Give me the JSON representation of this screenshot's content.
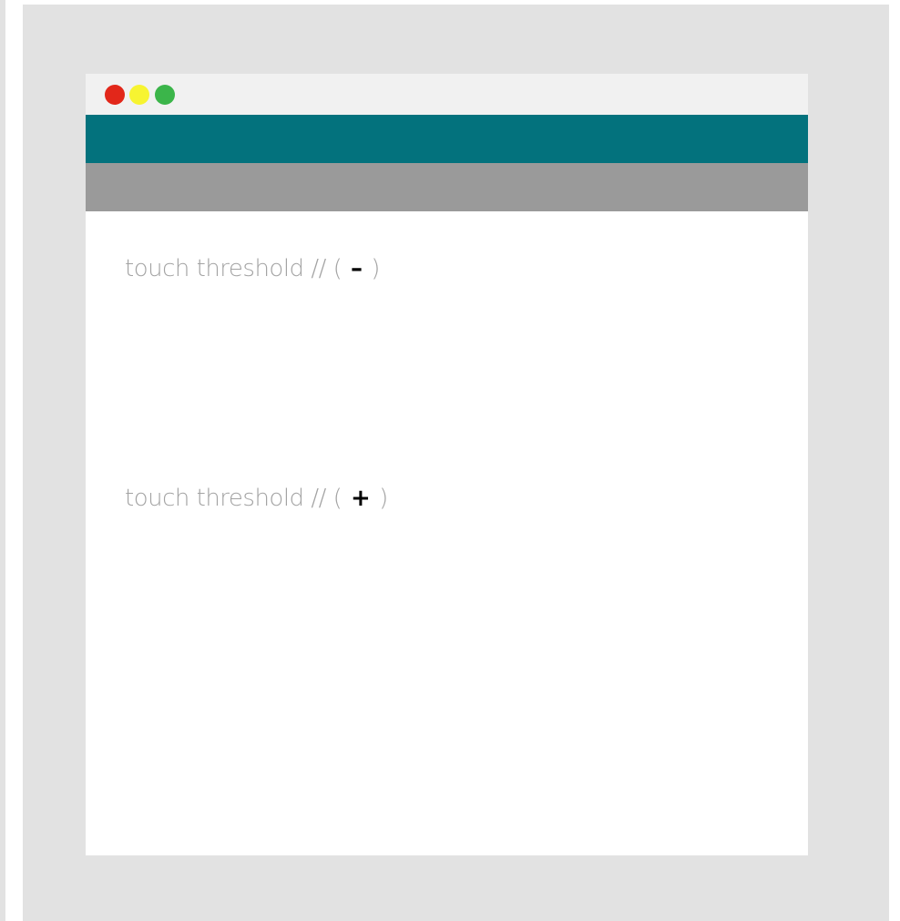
{
  "colors": {
    "backdrop": "#e2e2e2",
    "titlebar": "#f1f1f1",
    "header_bar": "#03727d",
    "sub_bar": "#9a9a9a",
    "traffic_red": "#e2271a",
    "traffic_yellow": "#f7f431",
    "traffic_green": "#3bb54a",
    "label_text": "#a3a3a3",
    "symbol_text": "#000000"
  },
  "window": {
    "traffic_lights": [
      "close",
      "minimize",
      "maximize"
    ]
  },
  "controls": {
    "decrease": {
      "label": "touch threshold // (",
      "symbol": "–",
      "close": ")"
    },
    "increase": {
      "label": "touch threshold // (",
      "symbol": "+",
      "close": ")"
    }
  }
}
